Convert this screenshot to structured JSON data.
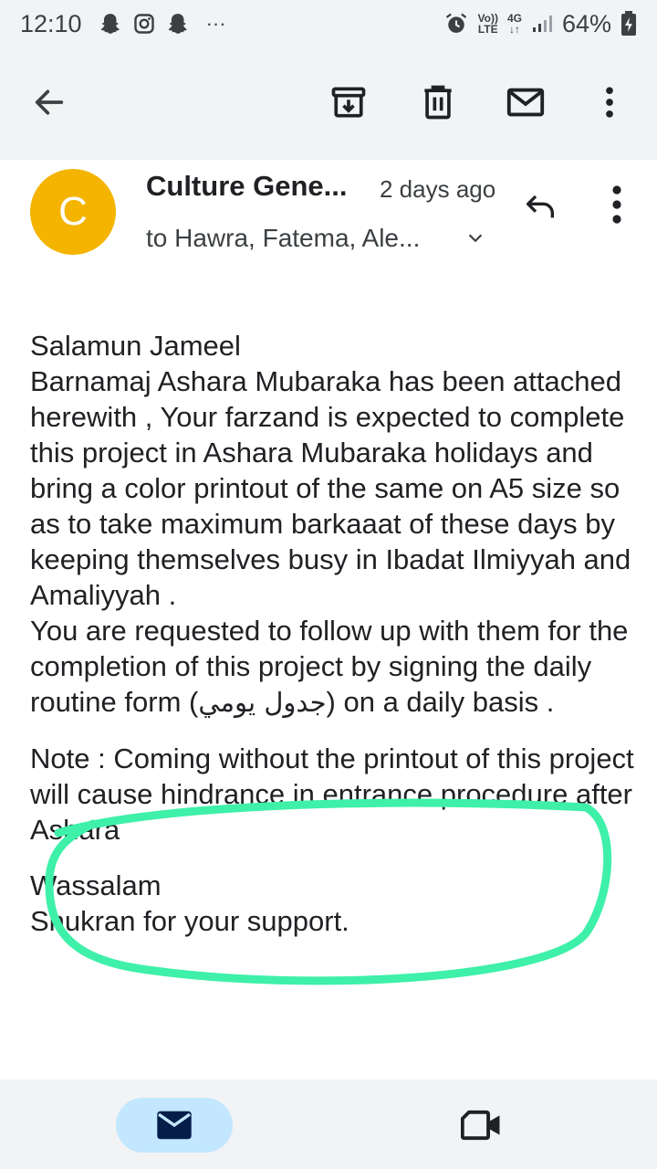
{
  "status_bar": {
    "time": "12:10",
    "left_icons": [
      "snapchat-icon",
      "instagram-icon",
      "snapchat-icon",
      "more-notifications-icon"
    ],
    "overflow": "···",
    "volte_top": "Vo))",
    "volte_bottom": "LTE",
    "network_top": "4G",
    "network_bottom": "↓↑",
    "battery": "64%"
  },
  "toolbar": {
    "icons": [
      "back-arrow-icon",
      "archive-icon",
      "delete-icon",
      "mark-unread-icon",
      "more-vert-icon"
    ]
  },
  "email": {
    "avatar_letter": "C",
    "avatar_color": "#f4b400",
    "sender": "Culture Gene...",
    "time_ago": "2 days ago",
    "recipients": "to Hawra, Fatema, Ale...",
    "body": {
      "greeting": "Salamun Jameel",
      "para1": "Barnamaj Ashara Mubaraka has been attached herewith , Your farzand is expected to complete this project in Ashara Mubaraka holidays and bring a color printout of the same on A5 size so as to take maximum barkaaat of these days by keeping themselves busy in Ibadat Ilmiyyah and Amaliyyah .",
      "para2_start": "You are requested to follow up with them for the completion of this project by signing the daily routine form (",
      "para2_arabic": "جدول يومي",
      "para2_end": ") on a daily basis .",
      "note": "Note : Coming without the printout of this project will cause hindrance in entrance procedure after Ashara",
      "closing": "Wassalam",
      "thanks": "Shukran for your support."
    },
    "highlight_color": "#3ef0a8"
  },
  "bottom_nav": {
    "active_tab_color": "#c2e7ff",
    "icons": [
      "mail-icon",
      "video-icon"
    ]
  }
}
